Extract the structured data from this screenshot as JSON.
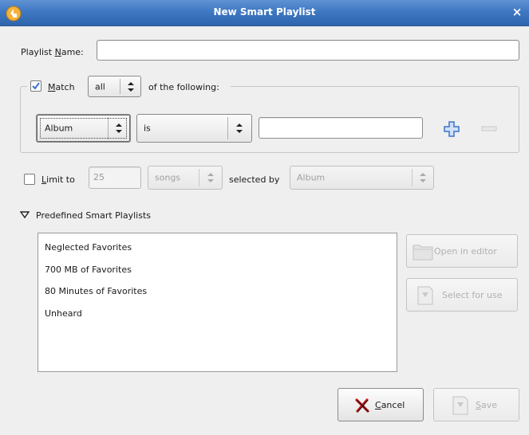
{
  "window": {
    "title": "New Smart Playlist",
    "close_glyph": "×"
  },
  "playlist_name": {
    "label_pre": "Playlist ",
    "label_ul": "N",
    "label_post": "ame:",
    "value": ""
  },
  "match": {
    "checked": true,
    "label_ul": "M",
    "label_post": "atch",
    "combo_value": "all",
    "suffix": "of the following:"
  },
  "criteria": {
    "field": "Album",
    "operator": "is",
    "value": "",
    "add_icon": "plus-icon",
    "remove_icon": "minus-icon"
  },
  "limit": {
    "checked": false,
    "label_ul": "L",
    "label_post": "imit to",
    "amount": "25",
    "unit": "songs",
    "selected_by_label": "selected by",
    "selected_by_value": "Album"
  },
  "predefined": {
    "header": "Predefined Smart Playlists",
    "items": [
      "Neglected Favorites",
      "700 MB of Favorites",
      "80 Minutes of Favorites",
      "Unheard"
    ],
    "open_button": "Open in editor",
    "select_button": "Select for use"
  },
  "footer": {
    "cancel_ul": "C",
    "cancel_post": "ancel",
    "save_ul": "S",
    "save_post": "ave"
  },
  "colors": {
    "titlebar": "#3f78c2",
    "accent_blue": "#3b73c8",
    "window_bg": "#efefef"
  }
}
